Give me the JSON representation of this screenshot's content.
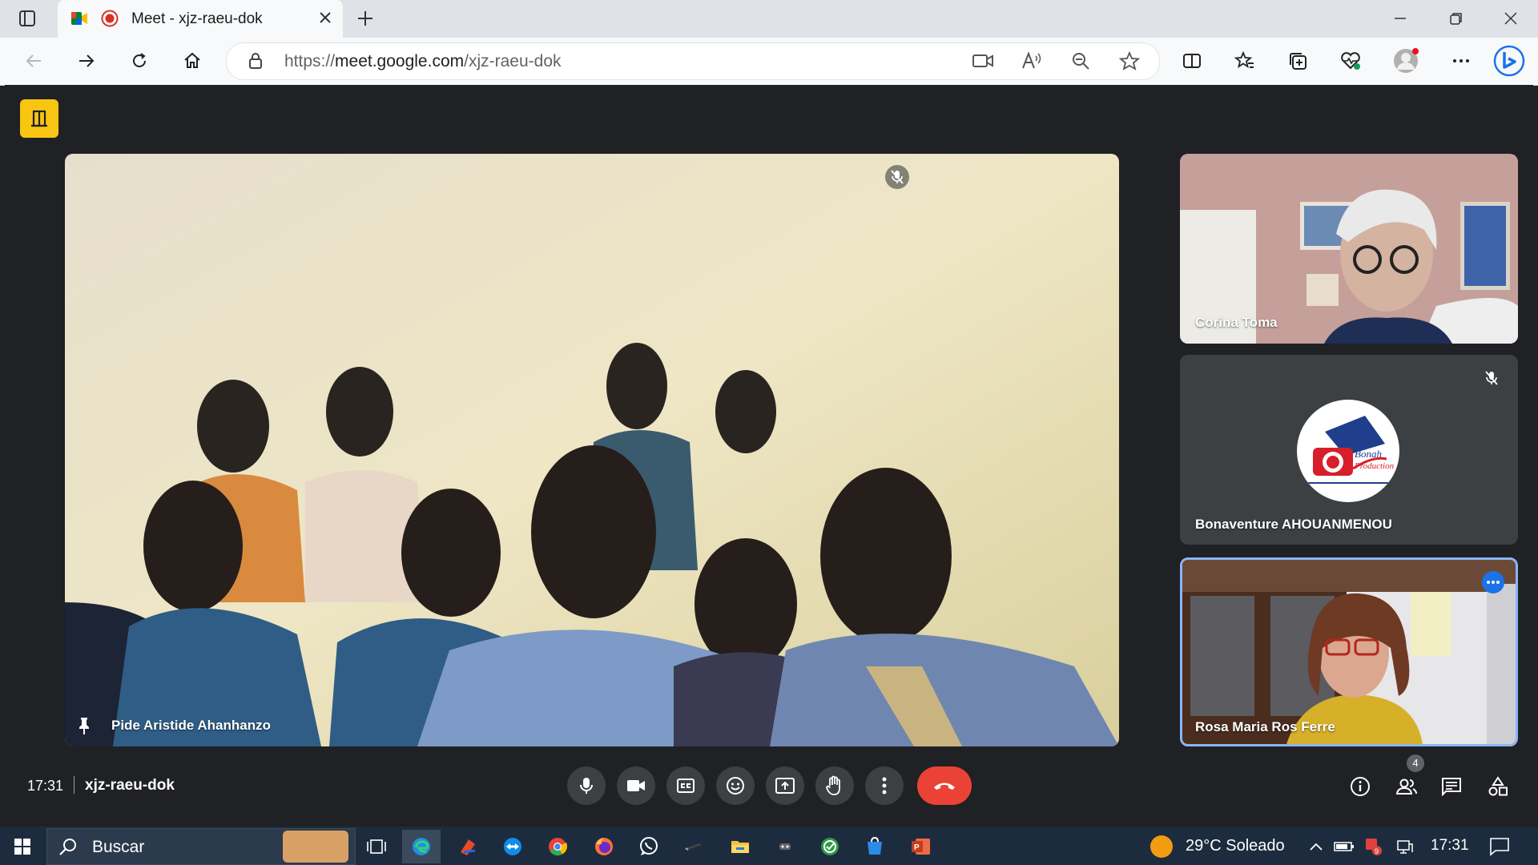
{
  "browser": {
    "tab_title": "Meet - xjz-raeu-dok",
    "url_prefix": "https://",
    "url_host": "meet.google.com",
    "url_path": "/xjz-raeu-dok"
  },
  "meeting": {
    "time": "17:31",
    "code": "xjz-raeu-dok",
    "participant_count": "4"
  },
  "participants": {
    "main": {
      "name": "Pide Aristide Ahanhanzo",
      "muted": true,
      "pinned": true
    },
    "side": [
      {
        "name": "Corina Toma",
        "muted": false
      },
      {
        "name": "Bonaventure AHOUANMENOU",
        "muted": true,
        "avatar_lines": [
          "Bonah",
          "Production"
        ]
      },
      {
        "name": "Rosa Maria Ros Ferre",
        "muted": false,
        "highlighted": true
      }
    ]
  },
  "taskbar": {
    "search_placeholder": "Buscar",
    "weather": "29°C  Soleado",
    "clock": "17:31",
    "notification_badge": "9"
  },
  "colors": {
    "meet_bg": "#202124",
    "end_call": "#ea4335",
    "highlight": "#8ab4f8",
    "companion_badge": "#f9c513",
    "taskbar": "#1c2c3e"
  }
}
